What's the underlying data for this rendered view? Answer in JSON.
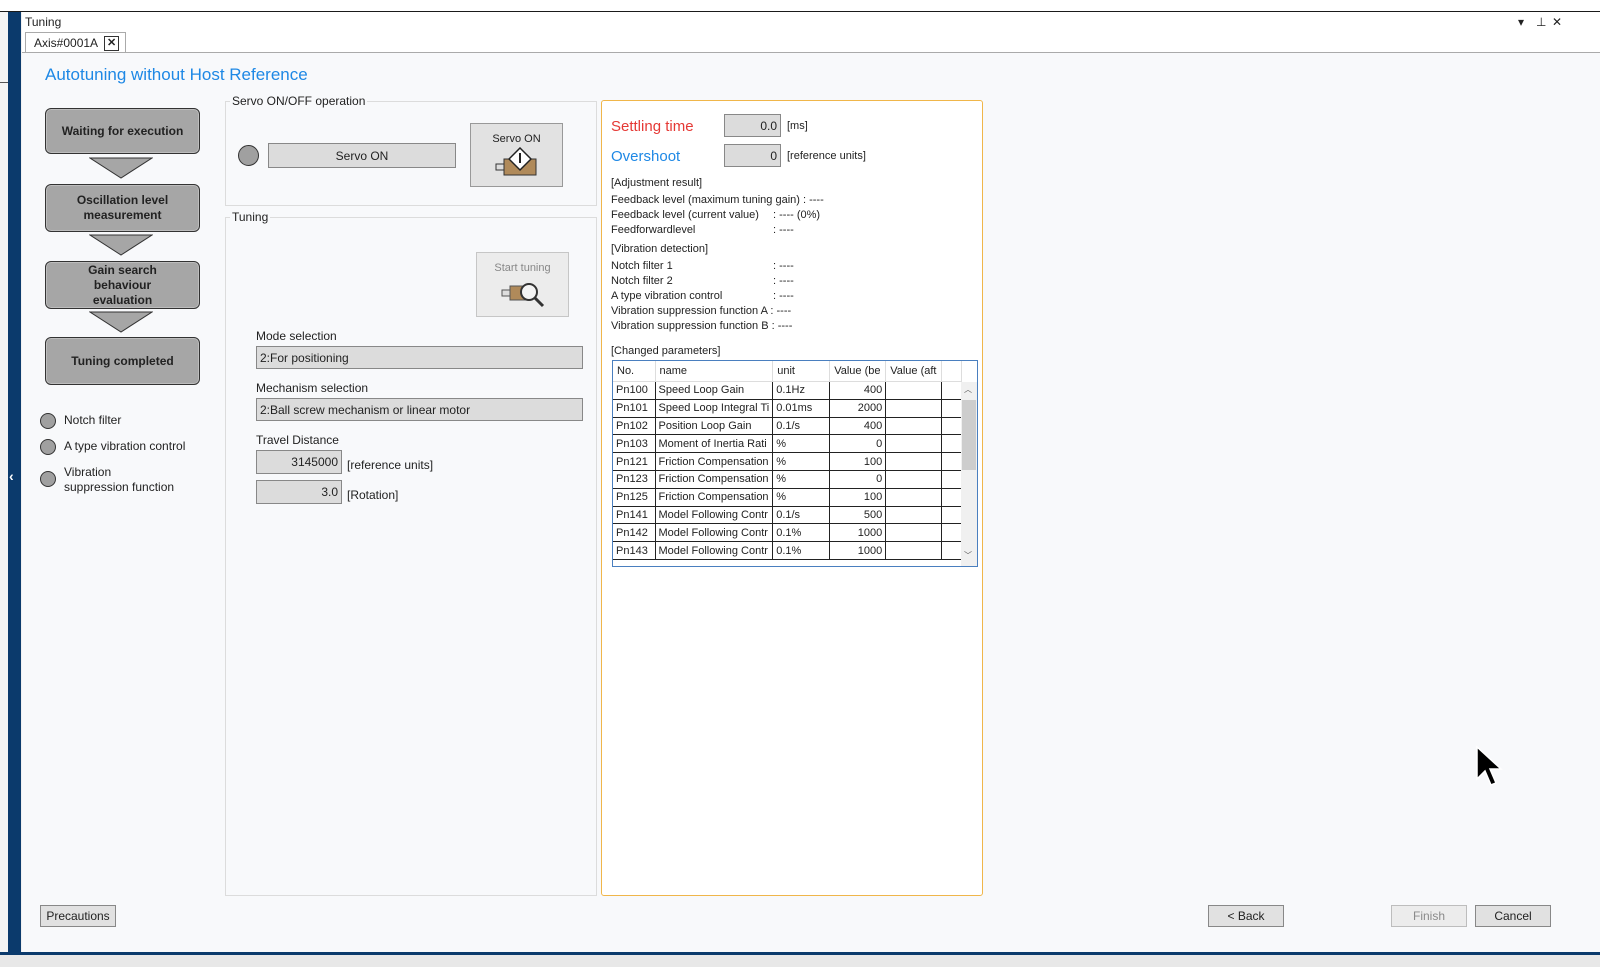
{
  "window": {
    "title": "Tuning",
    "controls": {
      "dropdown": "▾",
      "pin": "⊥",
      "close": "✕"
    }
  },
  "tabs": [
    {
      "label": "Axis#0001A",
      "close": "✕"
    }
  ],
  "heading": "Autotuning without Host Reference",
  "steps": [
    {
      "label": "Waiting for execution"
    },
    {
      "label": "Oscillation level measurement"
    },
    {
      "label": "Gain search behaviour evaluation"
    },
    {
      "label": "Tuning completed"
    }
  ],
  "indicators": [
    {
      "label": "Notch filter"
    },
    {
      "label": "A type vibration control"
    },
    {
      "label": "Vibration suppression function"
    }
  ],
  "servo": {
    "group_label": "Servo ON/OFF operation",
    "status_text": "Servo ON",
    "button_label": "Servo ON"
  },
  "tuning": {
    "group_label": "Tuning",
    "start_button_label": "Start tuning",
    "mode_label": "Mode selection",
    "mode_value": "2:For positioning",
    "mechanism_label": "Mechanism selection",
    "mechanism_value": "2:Ball screw mechanism or linear motor",
    "travel_label": "Travel Distance",
    "travel_value": "3145000",
    "travel_unit": "[reference units]",
    "rotation_value": "3.0",
    "rotation_unit": "[Rotation]"
  },
  "results": {
    "settling_label": "Settling time",
    "settling_value": "0.0",
    "settling_unit": "[ms]",
    "overshoot_label": "Overshoot",
    "overshoot_value": "0",
    "overshoot_unit": "[reference units]",
    "adjustment_header": "[Adjustment result]",
    "adjustment": [
      {
        "label": "Feedback level (maximum tuning gain) : ----",
        "value": ""
      },
      {
        "label": "Feedback level (current value)",
        "value": ": ---- (0%)"
      },
      {
        "label": "Feedforwardlevel",
        "value": ": ----"
      }
    ],
    "vibration_header": "[Vibration detection]",
    "vibration": [
      {
        "label": "Notch filter 1",
        "value": ": ----"
      },
      {
        "label": "Notch filter 2",
        "value": ": ----"
      },
      {
        "label": "A type vibration control",
        "value": ": ----"
      },
      {
        "label": "Vibration suppression function A : ----",
        "value": ""
      },
      {
        "label": "Vibration suppression function B : ----",
        "value": ""
      }
    ],
    "changed_header": "[Changed parameters]"
  },
  "params": {
    "columns": [
      "No.",
      "name",
      "unit",
      "Value (be",
      "Value (aft"
    ],
    "rows": [
      {
        "no": "Pn100",
        "name": "Speed Loop Gain",
        "unit": "0.1Hz",
        "before": "400",
        "after": ""
      },
      {
        "no": "Pn101",
        "name": "Speed Loop Integral Ti",
        "unit": "0.01ms",
        "before": "2000",
        "after": ""
      },
      {
        "no": "Pn102",
        "name": "Position Loop Gain",
        "unit": "0.1/s",
        "before": "400",
        "after": ""
      },
      {
        "no": "Pn103",
        "name": "Moment of Inertia Rati",
        "unit": "%",
        "before": "0",
        "after": ""
      },
      {
        "no": "Pn121",
        "name": "Friction Compensation",
        "unit": "%",
        "before": "100",
        "after": ""
      },
      {
        "no": "Pn123",
        "name": "Friction Compensation",
        "unit": "%",
        "before": "0",
        "after": ""
      },
      {
        "no": "Pn125",
        "name": "Friction Compensation",
        "unit": "%",
        "before": "100",
        "after": ""
      },
      {
        "no": "Pn141",
        "name": "Model Following Contr",
        "unit": "0.1/s",
        "before": "500",
        "after": ""
      },
      {
        "no": "Pn142",
        "name": "Model Following Contr",
        "unit": "0.1%",
        "before": "1000",
        "after": ""
      },
      {
        "no": "Pn143",
        "name": "Model Following Contr",
        "unit": "0.1%",
        "before": "1000",
        "after": ""
      }
    ]
  },
  "footer": {
    "precautions": "Precautions",
    "back": "< Back",
    "finish": "Finish",
    "cancel": "Cancel"
  },
  "rail": {
    "collapse_arrow": "‹"
  }
}
